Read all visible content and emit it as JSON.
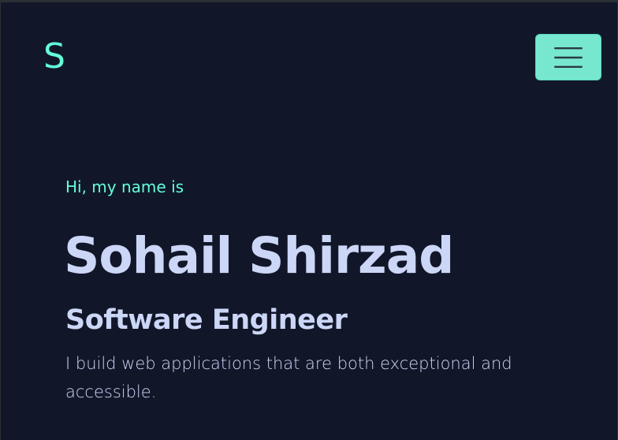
{
  "header": {
    "logo_letter": "S",
    "menu_icon": "hamburger-menu-icon"
  },
  "hero": {
    "greeting": "Hi, my name is",
    "name": "Sohail Shirzad",
    "role": "Software Engineer",
    "description": "I build web applications that are both exceptional and accessible."
  },
  "colors": {
    "background": "#111729",
    "accent": "#64ffda",
    "button": "#77e8cf",
    "text": "#ccd6f6"
  }
}
